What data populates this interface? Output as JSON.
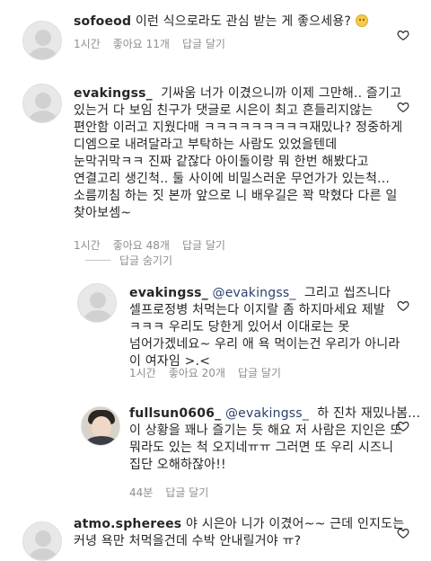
{
  "comments": [
    {
      "username": "sofoeod",
      "lines": [
        "이런 식으로라도 관심 받는 게 좋으세용?"
      ],
      "emoji": "worried-face-emoji",
      "time": "1시간",
      "likes": "좋아요 11개",
      "reply": "답글 달기"
    },
    {
      "username": "evakingss_",
      "lines": [
        "기싸움 너가 이겼으니까 이제 그만해.. 즐기고",
        "있는거 다 보임 친구가 댓글로 시은이 최고 흔들리지않는",
        "편안함 이러고 지웠다매 ㅋㅋㅋㅋㅋㅋㅋㅋㅋ재밌나? 정중하게",
        "디엠으로 내려달라고 부탁하는 사람도 있었을텐데",
        "눈막귀막ㅋㅋ 진짜 같잖다 아이돌이랑 뭐 한번 해봤다고",
        "연결고리 생긴척.. 둘 사이에 비밀스러운 무언가가 있는척...",
        "소름끼침 하는 짓 본까 앞으로 니 배우길은 꽉 막혔다 다른 일",
        "찾아보셈~"
      ],
      "time": "1시간",
      "likes": "좋아요 48개",
      "reply": "답글 달기"
    }
  ],
  "hide_replies": "답글 숨기기",
  "replies": [
    {
      "username": "evakingss_",
      "mention": "@evakingss_",
      "first_line_rest": "그리고 씹즈니다",
      "lines": [
        "셀프로정병 처먹는다 이지랄 좀 하지마세요 제발",
        "ㅋㅋㅋ 우리도 당한게 있어서 이대로는 못",
        "넘어가겠네요~ 우리 애 욕 먹이는건 우리가 아니라",
        "이 여자임 >.<"
      ],
      "time": "1시간",
      "likes": "좋아요 20개",
      "reply": "답글 달기"
    },
    {
      "username": "fullsun0606_",
      "mention": "@evakingss_",
      "first_line_rest": "하 진차 재밌나봄...",
      "lines": [
        "이 상황을 꽤나 즐기는 듯 해요 저 사람은 지인은 또",
        "뭐라도 있는 척 오지네ㅠㅠ 그러면 또 우리 시즈니",
        "집단 오해하잖아!!"
      ],
      "time": "44분",
      "likes": "",
      "reply": "답글 달기"
    }
  ],
  "last_comment": {
    "username": "atmo.spherees",
    "lines": [
      "야 시은아 니가 이겼어~~ 근데 인지도는",
      "커녕 욕만 처먹을건데 수박 안내릴거야 ㅠ?"
    ]
  }
}
